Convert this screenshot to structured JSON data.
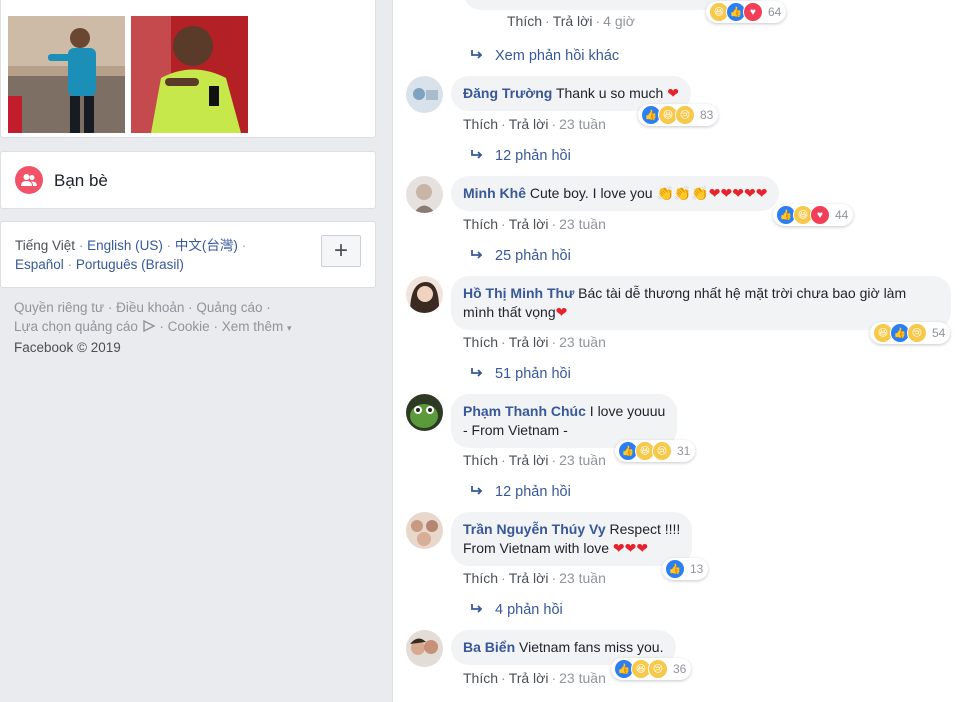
{
  "left": {
    "friends_label": "Bạn bè",
    "languages": [
      {
        "label": "Tiếng Việt",
        "current": true
      },
      {
        "label": "English (US)",
        "current": false
      },
      {
        "label": "中文(台灣)",
        "current": false
      },
      {
        "label": "Español",
        "current": false
      },
      {
        "label": "Português (Brasil)",
        "current": false
      }
    ],
    "add_language_label": "+",
    "footer": {
      "privacy": "Quyền riêng tư",
      "terms": "Điều khoản",
      "ads": "Quảng cáo",
      "ad_choices": "Lựa chọn quảng cáo",
      "cookie": "Cookie",
      "more": "Xem thêm",
      "copyright": "Facebook © 2019"
    }
  },
  "comments_top": {
    "actions": {
      "like": "Thích",
      "reply": "Trả lời",
      "time": "4 giờ"
    },
    "reaction_count": "64",
    "more_replies": "Xem phản hồi khác"
  },
  "comments": [
    {
      "author": "Đăng Trường",
      "text": "Thank u so much",
      "suffix": "❤",
      "like": "Thích",
      "reply": "Trả lời",
      "time": "23 tuần",
      "reaction_count": "83",
      "replies": "12 phản hồi"
    },
    {
      "author": "Minh Khê",
      "text": "Cute boy. I love you",
      "suffix": "👏👏👏❤❤❤❤❤",
      "like": "Thích",
      "reply": "Trả lời",
      "time": "23 tuần",
      "reaction_count": "44",
      "replies": "25 phản hồi"
    },
    {
      "author": "Hồ Thị Minh Thư",
      "text": "Bác tài dễ thương nhất hệ mặt trời chưa bao giờ làm mình thất vọng",
      "suffix": "❤",
      "like": "Thích",
      "reply": "Trả lời",
      "time": "23 tuần",
      "reaction_count": "54",
      "replies": "51 phản hồi"
    },
    {
      "author": "Phạm Thanh Chúc",
      "text": "I love youuu",
      "line2": "- From Vietnam -",
      "like": "Thích",
      "reply": "Trả lời",
      "time": "23 tuần",
      "reaction_count": "31",
      "replies": "12 phản hồi"
    },
    {
      "author": "Trần Nguyễn Thúy Vy",
      "text": "Respect !!!!",
      "line2": "From Vietnam with love",
      "suffix": "❤❤❤",
      "like": "Thích",
      "reply": "Trả lời",
      "time": "23 tuần",
      "reaction_count": "13",
      "replies": "4 phản hồi"
    },
    {
      "author": "Ba Biển",
      "text": "Vietnam fans miss you.",
      "like": "Thích",
      "reply": "Trả lời",
      "time": "23 tuần",
      "reaction_count": "36"
    }
  ],
  "colors": {
    "link": "#385898",
    "friends_icon": "#f35369",
    "like": "#2a7ff5",
    "love": "#f33e58"
  }
}
